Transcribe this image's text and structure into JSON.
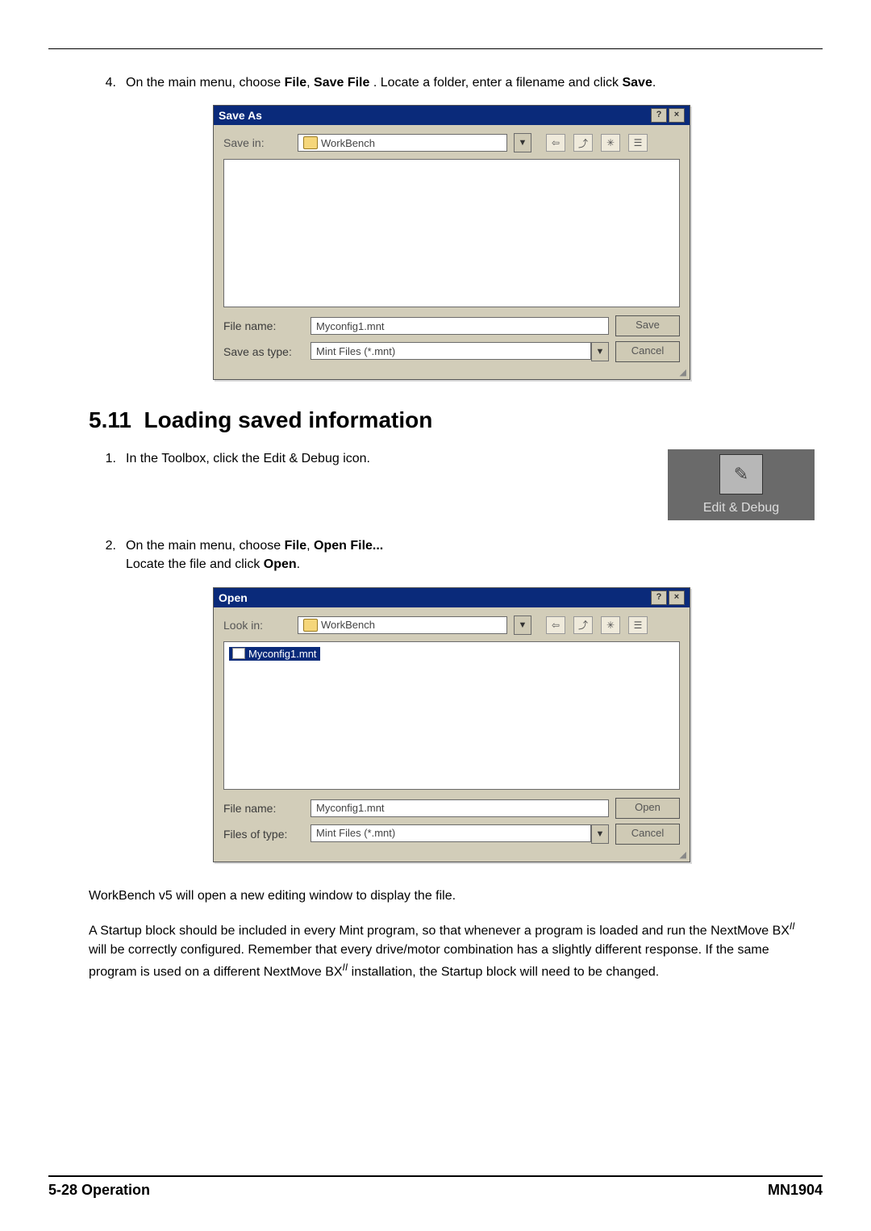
{
  "step4": {
    "num": "4.",
    "pre": "On the main menu, choose ",
    "b1": "File",
    "mid1": ", ",
    "b2": "Save File",
    "post1": " . Locate a folder, enter a filename and click ",
    "b3": "Save",
    "post2": "."
  },
  "saveDialog": {
    "title": "Save As",
    "lookLabel": "Save in:",
    "folder": "WorkBench",
    "filenameLabel": "File name:",
    "filename": "Myconfig1.mnt",
    "typeLabel": "Save as type:",
    "type": "Mint Files (*.mnt)",
    "primary": "Save",
    "cancel": "Cancel",
    "helpBtn": "?",
    "closeBtn": "×"
  },
  "section": {
    "num": "5.11",
    "title": "Loading saved information"
  },
  "step1": {
    "num": "1.",
    "text": "In the Toolbox, click the Edit & Debug icon."
  },
  "toolChip": {
    "label": "Edit & Debug"
  },
  "step2": {
    "num": "2.",
    "pre": "On the main menu, choose ",
    "b1": "File",
    "mid1": ", ",
    "b2": "Open File...",
    "line2a": "Locate the file and click ",
    "b3": "Open",
    "line2b": "."
  },
  "openDialog": {
    "title": "Open",
    "lookLabel": "Look in:",
    "folder": "WorkBench",
    "fileItem": "Myconfig1.mnt",
    "filenameLabel": "File name:",
    "filename": "Myconfig1.mnt",
    "typeLabel": "Files of type:",
    "type": "Mint Files (*.mnt)",
    "primary": "Open",
    "cancel": "Cancel",
    "helpBtn": "?",
    "closeBtn": "×"
  },
  "para1": "WorkBench v5 will open a new editing window to display the file.",
  "para2": {
    "a": "A Startup block should be included in every Mint program, so that whenever a program is loaded and run the NextMove BX",
    "ii": "II",
    "b": " will be correctly configured.  Remember that every drive/motor combination has a slightly different response. If the same program is used on a different NextMove BX",
    "c": " installation, the Startup block will need to be changed."
  },
  "footer": {
    "left": "5-28  Operation",
    "right": "MN1904"
  }
}
